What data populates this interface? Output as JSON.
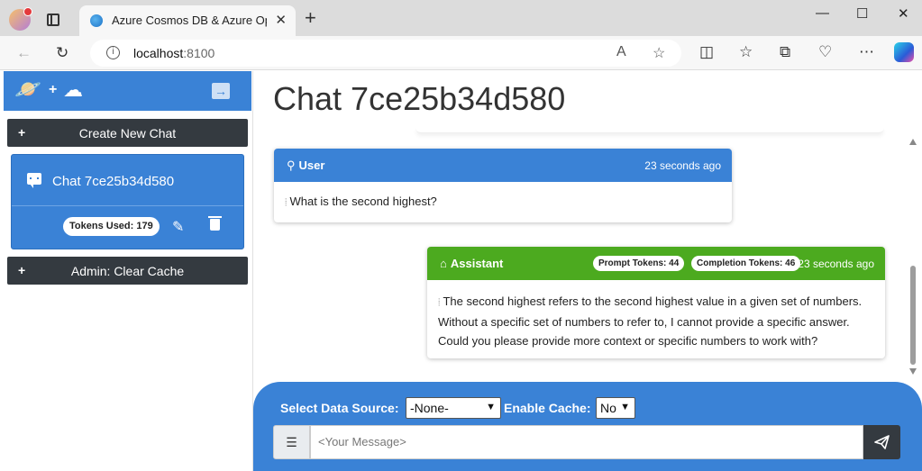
{
  "browser": {
    "tab_title": "Azure Cosmos DB & Azure OpenAI",
    "tab_close": "✕",
    "new_tab": "+",
    "url_host": "localhost",
    "url_port": ":8100",
    "window_controls": {
      "minimize": "—",
      "maximize": "☐",
      "close": "✕"
    }
  },
  "sidebar": {
    "collapse_glyph": "→",
    "create_chat": {
      "plus": "+",
      "label": "Create New Chat"
    },
    "chat_item": {
      "name": "Chat 7ce25b34d580",
      "tokens_label": "Tokens Used: 179"
    },
    "clear_cache": {
      "plus": "+",
      "label": "Admin: Clear Cache"
    }
  },
  "main": {
    "title": "Chat 7ce25b34d580",
    "messages": [
      {
        "role": "User",
        "time": "23 seconds ago",
        "text": "What is the second highest?"
      },
      {
        "role": "Assistant",
        "time": "23 seconds ago",
        "prompt_tokens": "Prompt Tokens: 44",
        "completion_tokens": "Completion Tokens: 46",
        "text": "The second highest refers to the second highest value in a given set of numbers. Without a specific set of numbers to refer to, I cannot provide a specific answer. Could you please provide more context or specific numbers to work with?"
      }
    ]
  },
  "input": {
    "data_source_label": "Select Data Source:",
    "data_source_value": "-None-",
    "cache_label": "Enable Cache:",
    "cache_value": "No",
    "placeholder": "<Your Message>"
  },
  "colors": {
    "primary": "#3a82d6",
    "assistant": "#4caa1f",
    "dark_button": "#343a40"
  }
}
